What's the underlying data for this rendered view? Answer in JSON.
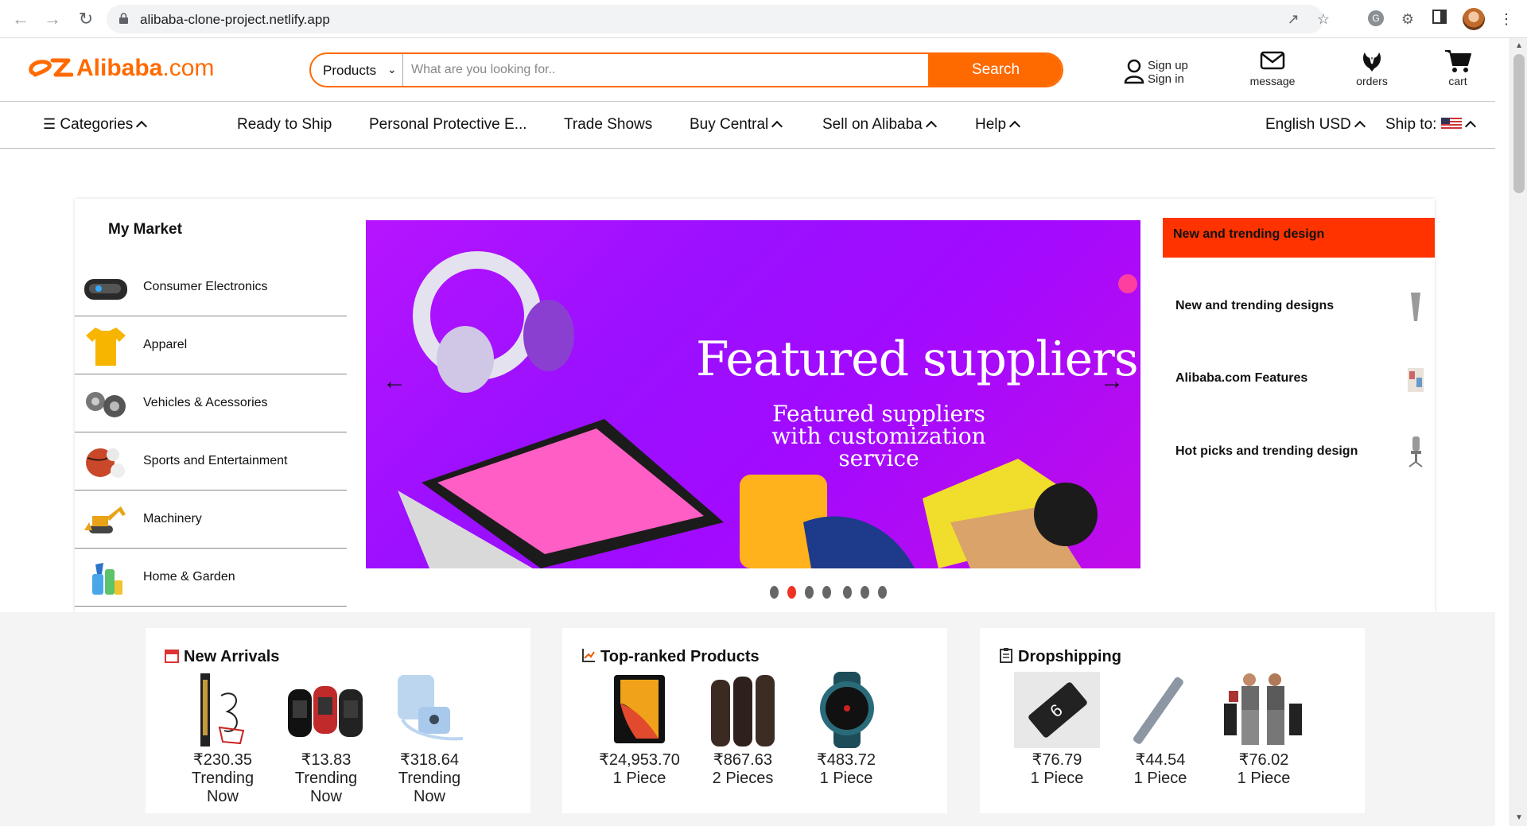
{
  "browser": {
    "url": "alibaba-clone-project.netlify.app"
  },
  "header": {
    "logo_brand": "Alibaba",
    "logo_suffix": ".com",
    "search_category": "Products",
    "search_placeholder": "What are you looking for..",
    "search_button": "Search",
    "sign_up": "Sign up",
    "sign_in": "Sign in",
    "message": "message",
    "orders": "orders",
    "cart": "cart"
  },
  "nav": {
    "categories": "Categories",
    "ready_to_ship": "Ready to Ship",
    "ppe": "Personal Protective E...",
    "trade_shows": "Trade Shows",
    "buy_central": "Buy Central",
    "sell_on_alibaba": "Sell on Alibaba",
    "help": "Help",
    "language": "English USD",
    "ship_to": "Ship to:"
  },
  "market": {
    "title": "My Market",
    "items": [
      {
        "label": "Consumer Electronics",
        "icon": "vr-headset-icon"
      },
      {
        "label": "Apparel",
        "icon": "tshirt-icon"
      },
      {
        "label": "Vehicles & Acessories",
        "icon": "car-parts-icon"
      },
      {
        "label": "Sports and Entertainment",
        "icon": "sports-balls-icon"
      },
      {
        "label": "Machinery",
        "icon": "excavator-icon"
      },
      {
        "label": "Home & Garden",
        "icon": "cleaning-supplies-icon"
      }
    ]
  },
  "banner": {
    "title": "Featured suppliers",
    "subtitle": "Featured suppliers with customization service",
    "active_slide": 2,
    "slide_count": 7
  },
  "trending": {
    "header": "New and trending design",
    "items": [
      {
        "label": "New and trending designs"
      },
      {
        "label": "Alibaba.com Features"
      },
      {
        "label": "Hot picks and trending design"
      }
    ]
  },
  "panels": [
    {
      "title": "New Arrivals",
      "products": [
        {
          "price": "₹230.35",
          "sub1": "Trending",
          "sub2": "Now"
        },
        {
          "price": "₹13.83",
          "sub1": "Trending",
          "sub2": "Now"
        },
        {
          "price": "₹318.64",
          "sub1": "Trending",
          "sub2": "Now"
        }
      ]
    },
    {
      "title": "Top-ranked Products",
      "products": [
        {
          "price": "₹24,953.70",
          "sub1": "1 Piece"
        },
        {
          "price": "₹867.63",
          "sub1": "2 Pieces"
        },
        {
          "price": "₹483.72",
          "sub1": "1 Piece"
        }
      ]
    },
    {
      "title": "Dropshipping",
      "products": [
        {
          "price": "₹76.79",
          "sub1": "1 Piece"
        },
        {
          "price": "₹44.54",
          "sub1": "1 Piece"
        },
        {
          "price": "₹76.02",
          "sub1": "1 Piece"
        }
      ]
    }
  ],
  "colors": {
    "brand": "#ff6a00",
    "trend_header": "#ff3300",
    "banner": "#a50cff",
    "active_dot": "#ee3322"
  }
}
